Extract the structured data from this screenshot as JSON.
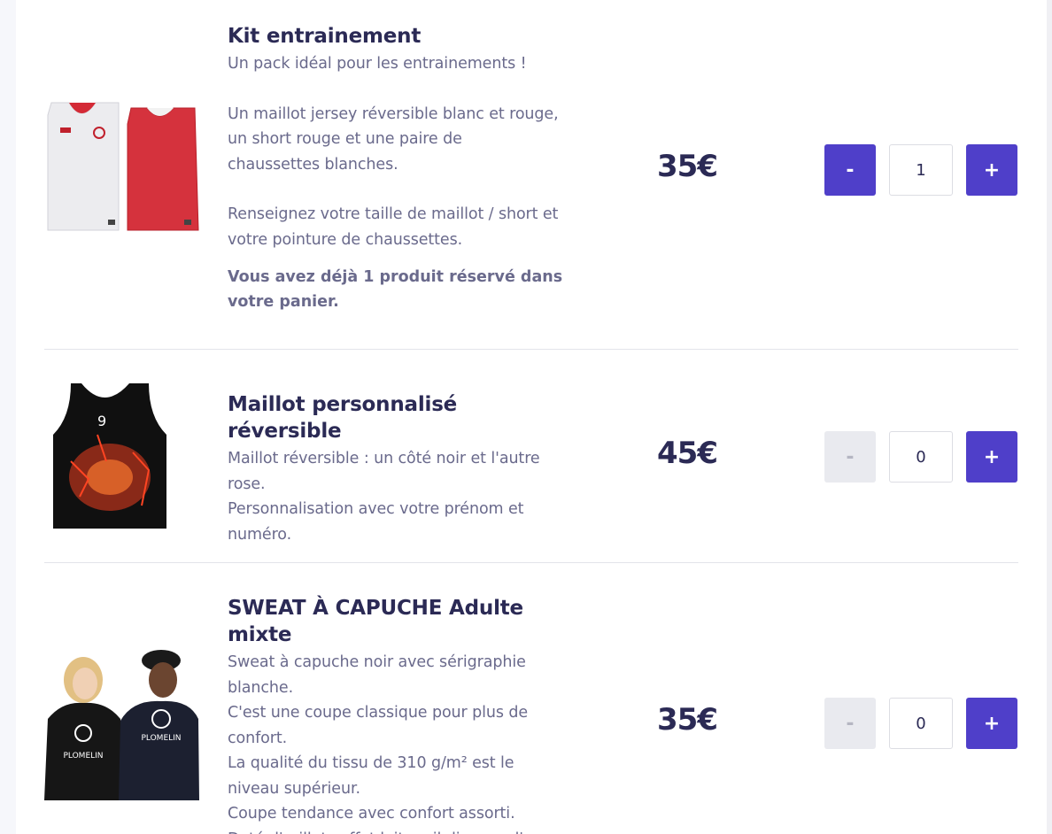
{
  "products": [
    {
      "title": "Kit entrainement",
      "lines": [
        "Un pack idéal pour les entrainements !",
        "",
        "Un maillot jersey réversible blanc et rouge,",
        "un short rouge et une paire de",
        "chaussettes blanches.",
        "",
        "Renseignez votre taille de maillot / short et",
        "votre pointure de chaussettes."
      ],
      "reserved_notice": "Vous avez déjà 1 produit réservé dans votre panier.",
      "price": "35€",
      "minus_label": "-",
      "plus_label": "+",
      "quantity": "1",
      "image": "reversible-jerseys-white-red"
    },
    {
      "title": "Maillot personnalisé réversible",
      "lines": [
        "Maillot réversible : un côté noir et l'autre",
        "rose.",
        "Personnalisation avec votre prénom et",
        "numéro."
      ],
      "price": "45€",
      "minus_label": "-",
      "plus_label": "+",
      "quantity": "0",
      "image": "black-custom-jersey"
    },
    {
      "title": "SWEAT À CAPUCHE Adulte mixte",
      "lines": [
        "Sweat à capuche noir avec sérigraphie",
        "blanche.",
        "C'est une coupe classique pour plus de",
        "confort.",
        "La qualité du tissu de 310 g/m² est le",
        "niveau supérieur.",
        "Coupe tendance avec confort assorti.",
        "Doté d'œillets effet laiton, il dispose d'une"
      ],
      "price": "35€",
      "minus_label": "-",
      "plus_label": "+",
      "quantity": "0",
      "image": "black-hoodies-models",
      "hoodie_print": "PLOMELIN"
    }
  ],
  "colors": {
    "accent": "#4f3fc9",
    "title": "#2b2a55",
    "text": "#6a6a8c",
    "disabled": "#e9eaef"
  }
}
